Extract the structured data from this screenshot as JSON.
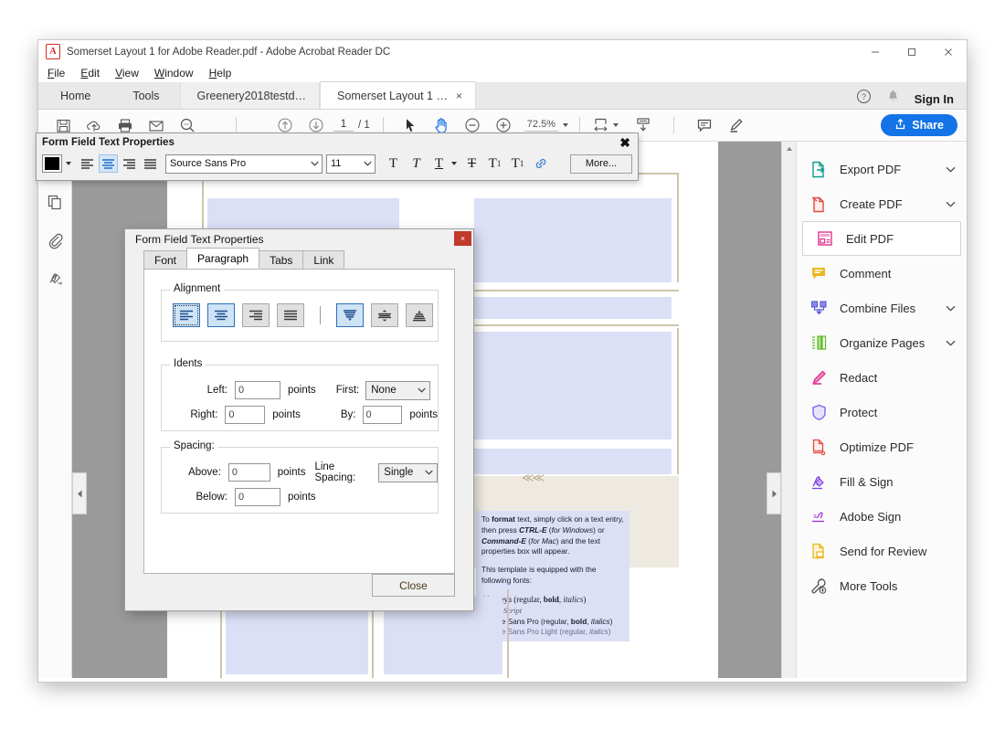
{
  "window": {
    "title": "Somerset Layout 1 for Adobe Reader.pdf - Adobe Acrobat Reader DC",
    "app_icon": "acrobat-icon",
    "minimize": "minimize-icon",
    "maximize": "maximize-icon",
    "close": "close-icon"
  },
  "menubar": {
    "items": [
      {
        "label": "File",
        "accel": "F"
      },
      {
        "label": "Edit",
        "accel": "E"
      },
      {
        "label": "View",
        "accel": "V"
      },
      {
        "label": "Window",
        "accel": "W"
      },
      {
        "label": "Help",
        "accel": "H"
      }
    ]
  },
  "tabstrip": {
    "home": "Home",
    "tools": "Tools",
    "documents": [
      {
        "label": "Greenery2018testd…",
        "active": false,
        "closable": false
      },
      {
        "label": "Somerset Layout 1 …",
        "active": true,
        "closable": true,
        "close_glyph": "×"
      }
    ],
    "help_icon": "help-circle-icon",
    "bell_icon": "bell-icon",
    "sign_in": "Sign In"
  },
  "toolbar": {
    "icons": [
      "save-icon",
      "upload-cloud-icon",
      "print-icon",
      "email-icon",
      "zoom-tool-icon"
    ],
    "page_up": "page-up-icon",
    "page_down": "page-down-icon",
    "page_current": "1",
    "page_separator": "/ 1",
    "page_total": "1",
    "select_tool": "cursor-icon",
    "hand_tool": "hand-icon",
    "zoom_out": "zoom-out-icon",
    "zoom_in": "zoom-in-icon",
    "zoom_level": "72.5%",
    "fit_width": "fit-width-icon",
    "scroll_mode": "scroll-mode-icon",
    "comment_icon": "comment-icon",
    "highlight_icon": "highlight-icon",
    "share_label": "Share",
    "share_icon": "share-icon",
    "share_color": "#1473e6"
  },
  "left_rail": {
    "items": [
      {
        "name": "thumbnails-icon"
      },
      {
        "name": "page-thumbnails-icon"
      },
      {
        "name": "attachments-icon"
      },
      {
        "name": "signatures-icon"
      }
    ]
  },
  "viewer": {
    "nav_left": "◀",
    "nav_right": "▶",
    "scroll_up": "▲",
    "document_text": {
      "para1": [
        {
          "t": "To ",
          "s": "n"
        },
        {
          "t": "format",
          "s": "b"
        },
        {
          "t": " text, simply click on a text entry, then press ",
          "s": "n"
        },
        {
          "t": "CTRL-E",
          "s": "bi"
        },
        {
          "t": " (",
          "s": "n"
        },
        {
          "t": "for Windows",
          "s": "i"
        },
        {
          "t": ") or ",
          "s": "n"
        },
        {
          "t": "Command-E",
          "s": "bi"
        },
        {
          "t": " (",
          "s": "n"
        },
        {
          "t": "for Mac",
          "s": "i"
        },
        {
          "t": ") and the text properties box will appear.",
          "s": "n"
        }
      ],
      "para2": "This template is equipped with the following fonts:",
      "font_list": [
        "Alegreya (regular, bold, italics)",
        "Rouge Script",
        "Source Sans Pro (regular, bold, italics)",
        "Source Sans Pro Light (regular, italics)"
      ]
    }
  },
  "right_panel": {
    "items": [
      {
        "label": "Export PDF",
        "icon": "export-pdf-icon",
        "chevron": true,
        "selected": false,
        "color": "#0f9e8e"
      },
      {
        "label": "Create PDF",
        "icon": "create-pdf-icon",
        "chevron": true,
        "selected": false,
        "color": "#e04a3f"
      },
      {
        "label": "Edit PDF",
        "icon": "edit-pdf-icon",
        "chevron": false,
        "selected": true,
        "color": "#e3338c"
      },
      {
        "label": "Comment",
        "icon": "comment-icon",
        "chevron": false,
        "selected": false,
        "color": "#e8b820"
      },
      {
        "label": "Combine Files",
        "icon": "combine-files-icon",
        "chevron": true,
        "selected": false,
        "color": "#5b5bd6"
      },
      {
        "label": "Organize Pages",
        "icon": "organize-pages-icon",
        "chevron": true,
        "selected": false,
        "color": "#5cb82a"
      },
      {
        "label": "Redact",
        "icon": "redact-icon",
        "chevron": false,
        "selected": false,
        "color": "#e0308c"
      },
      {
        "label": "Protect",
        "icon": "protect-icon",
        "chevron": false,
        "selected": false,
        "color": "#7b68ee"
      },
      {
        "label": "Optimize PDF",
        "icon": "optimize-pdf-icon",
        "chevron": false,
        "selected": false,
        "color": "#e04a3f"
      },
      {
        "label": "Fill & Sign",
        "icon": "fill-sign-icon",
        "chevron": false,
        "selected": false,
        "color": "#7b3fe4"
      },
      {
        "label": "Adobe Sign",
        "icon": "adobe-sign-icon",
        "chevron": false,
        "selected": false,
        "color": "#9b30d9"
      },
      {
        "label": "Send for Review",
        "icon": "send-for-review-icon",
        "chevron": false,
        "selected": false,
        "color": "#e8b820"
      },
      {
        "label": "More Tools",
        "icon": "more-tools-icon",
        "chevron": false,
        "selected": false,
        "color": "#5a5a5a"
      }
    ]
  },
  "text_properties_toolbar": {
    "title": "Form Field Text Properties",
    "close_glyph": "✖",
    "color_swatch": "#000000",
    "align_buttons": [
      {
        "name": "align-left",
        "active": false
      },
      {
        "name": "align-center",
        "active": true
      },
      {
        "name": "align-right",
        "active": false
      },
      {
        "name": "align-justify",
        "active": false
      }
    ],
    "font_family": "Source Sans Pro",
    "font_size": "11",
    "style_buttons": [
      {
        "name": "bold-button",
        "glyph": "T"
      },
      {
        "name": "italic-button",
        "glyph": "T"
      },
      {
        "name": "underline-button",
        "glyph": "T"
      },
      {
        "name": "strikethrough-button",
        "glyph": "T"
      },
      {
        "name": "superscript-button",
        "glyph": "T"
      },
      {
        "name": "subscript-button",
        "glyph": "T"
      },
      {
        "name": "link-button",
        "glyph": "link"
      }
    ],
    "more_label": "More..."
  },
  "dialog": {
    "title": "Form Field Text Properties",
    "close_glyph": "×",
    "tabs": [
      {
        "label": "Font",
        "active": false
      },
      {
        "label": "Paragraph",
        "active": true
      },
      {
        "label": "Tabs",
        "active": false
      },
      {
        "label": "Link",
        "active": false
      }
    ],
    "alignment": {
      "legend": "Alignment",
      "horizontal": [
        {
          "name": "align-left-button",
          "state": "focused"
        },
        {
          "name": "align-center-button",
          "state": "selected"
        },
        {
          "name": "align-right-button",
          "state": "normal"
        },
        {
          "name": "align-justify-button",
          "state": "normal"
        }
      ],
      "vertical": [
        {
          "name": "valign-top-button",
          "state": "selected"
        },
        {
          "name": "valign-middle-button",
          "state": "normal"
        },
        {
          "name": "valign-bottom-button",
          "state": "normal"
        }
      ]
    },
    "idents": {
      "legend": "Idents",
      "left_label": "Left:",
      "left_value": "0",
      "left_units": "points",
      "right_label": "Right:",
      "right_value": "0",
      "right_units": "points",
      "first_label": "First:",
      "first_value": "None",
      "by_label": "By:",
      "by_value": "0",
      "by_units": "points"
    },
    "spacing": {
      "legend": "Spacing:",
      "above_label": "Above:",
      "above_value": "0",
      "above_units": "points",
      "below_label": "Below:",
      "below_value": "0",
      "below_units": "points",
      "line_spacing_label": "Line Spacing:",
      "line_spacing_value": "Single"
    },
    "close_button": "Close"
  }
}
